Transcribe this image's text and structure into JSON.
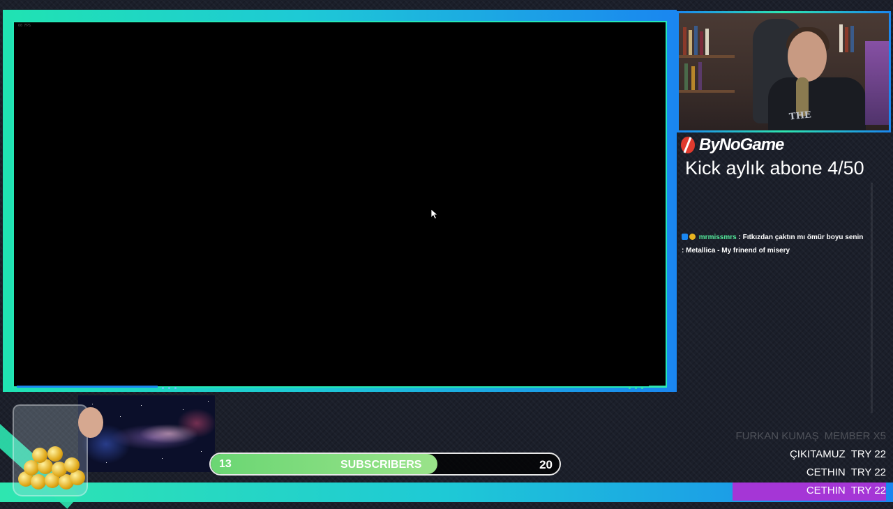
{
  "game": {
    "fps": "60 FPS"
  },
  "brand": {
    "name": "ByNoGame"
  },
  "kick": {
    "text": "Kick aylık abone 4/50"
  },
  "chat": {
    "messages": [
      {
        "user": "mrmissmrs",
        "text": ": Fıtkızdan çaktın mı ömür boyu senin"
      },
      {
        "user": "",
        "text": ": Metallica - My frinend of misery"
      }
    ]
  },
  "webcam": {
    "shirt_text": "THE"
  },
  "subscribers": {
    "current": "13",
    "label": "SUBSCRIBERS",
    "goal": "20",
    "progress_fraction": 0.65
  },
  "events": [
    {
      "name": "FURKAN KUMAŞ",
      "detail": "MEMBER X5",
      "style": "faded"
    },
    {
      "name": "ÇIKITAMUZ",
      "detail": "TRY 22",
      "style": "normal"
    },
    {
      "name": "CETHIN",
      "detail": "TRY 22",
      "style": "normal"
    },
    {
      "name": "CETHIN",
      "detail": "TRY 22",
      "style": "highlight"
    }
  ],
  "colors": {
    "teal": "#2ee6b0",
    "blue": "#1a86f0",
    "purple": "#a536d6",
    "green": "#6ad673"
  }
}
